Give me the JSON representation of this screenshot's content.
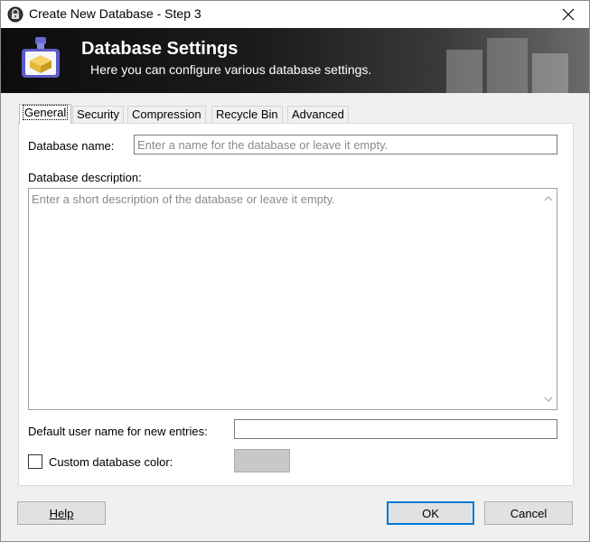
{
  "window": {
    "title": "Create New Database - Step 3"
  },
  "banner": {
    "title": "Database Settings",
    "subtitle": "Here you can configure various database settings."
  },
  "tabs": [
    {
      "label": "General",
      "active": true
    },
    {
      "label": "Security",
      "active": false
    },
    {
      "label": "Compression",
      "active": false
    },
    {
      "label": "Recycle Bin",
      "active": false
    },
    {
      "label": "Advanced",
      "active": false
    }
  ],
  "general": {
    "db_name_label": "Database name:",
    "db_name_placeholder": "Enter a name for the database or leave it empty.",
    "db_name_value": "",
    "db_desc_label": "Database description:",
    "db_desc_placeholder": "Enter a short description of the database or leave it empty.",
    "db_desc_value": "",
    "default_user_label": "Default user name for new entries:",
    "default_user_value": "",
    "custom_color_label": "Custom database color:",
    "custom_color_checked": false,
    "custom_color_swatch": "#c8c8c8"
  },
  "buttons": {
    "help_label": "Help",
    "ok_label": "OK",
    "cancel_label": "Cancel"
  },
  "icons": {
    "title": "keepass-lock-icon",
    "banner": "database-settings-icon",
    "close": "close-icon"
  }
}
